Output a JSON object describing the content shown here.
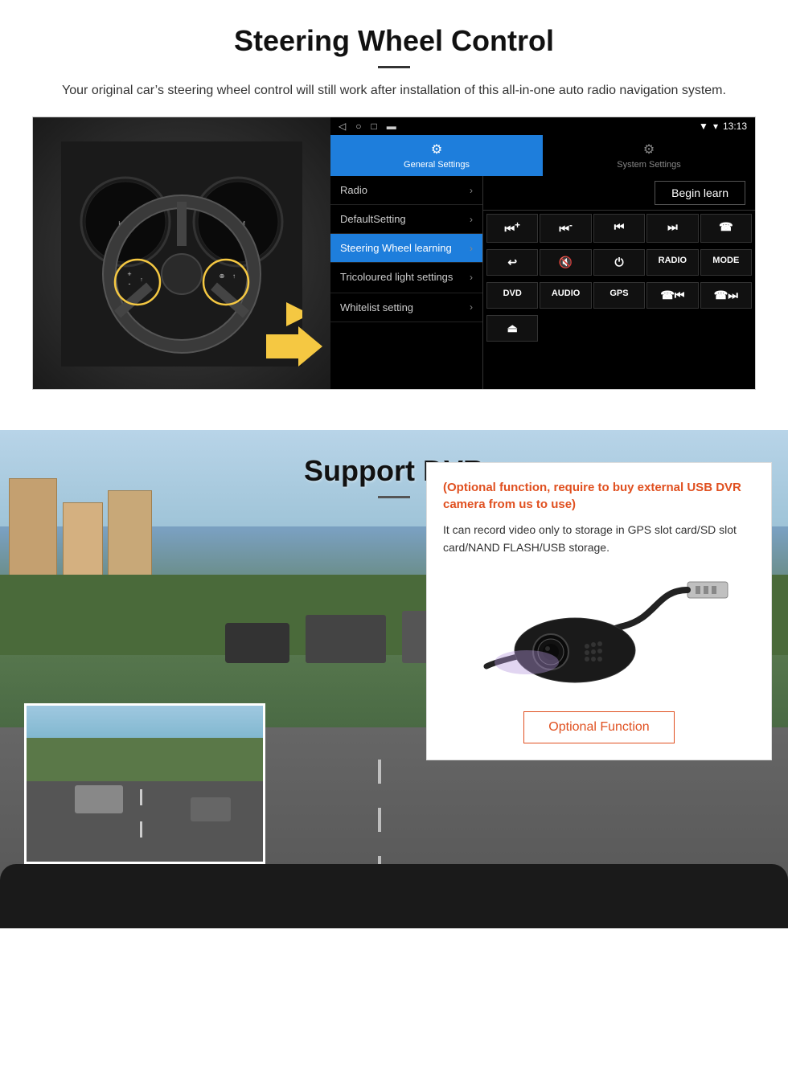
{
  "section1": {
    "title": "Steering Wheel Control",
    "subtitle": "Your original car’s steering wheel control will still work after installation of this all-in-one auto radio navigation system.",
    "android_statusbar": {
      "time": "13:13",
      "nav_icons": [
        "◁",
        "○",
        "□",
        "▬"
      ]
    },
    "tabs": [
      {
        "label": "General Settings",
        "icon": "⚙",
        "active": true
      },
      {
        "label": "System Settings",
        "icon": "⚙",
        "active": false
      }
    ],
    "menu_items": [
      {
        "label": "Radio",
        "active": false
      },
      {
        "label": "DefaultSetting",
        "active": false
      },
      {
        "label": "Steering Wheel learning",
        "active": true
      },
      {
        "label": "Tricoloured light settings",
        "active": false
      },
      {
        "label": "Whitelist setting",
        "active": false
      }
    ],
    "begin_learn": "Begin learn",
    "ctrl_buttons_row1": [
      "⏮+",
      "⏮-",
      "⏮⏮",
      "⏭⏭",
      "☎"
    ],
    "ctrl_buttons_row2": [
      "↩",
      "🔇",
      "⏻",
      "RADIO",
      "MODE"
    ],
    "ctrl_buttons_row3": [
      "DVD",
      "AUDIO",
      "GPS",
      "☎⏮",
      "☎⏭"
    ],
    "ctrl_buttons_row4": [
      "⏏"
    ]
  },
  "section2": {
    "title": "Support DVR",
    "optional_text": "(Optional function, require to buy external USB DVR camera from us to use)",
    "desc_text": "It can record video only to storage in GPS slot card/SD slot card/NAND FLASH/USB storage.",
    "optional_function_btn": "Optional Function"
  }
}
